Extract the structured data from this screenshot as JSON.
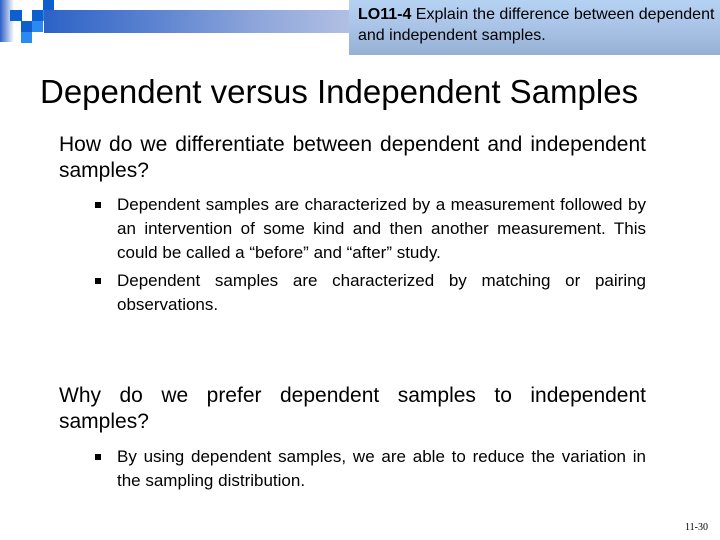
{
  "slide": {
    "learning_objective": {
      "code": "LO11-4",
      "text": " Explain the difference between dependent and independent samples."
    },
    "title": "Dependent versus Independent Samples",
    "sections": [
      {
        "question": "How do we differentiate between dependent and independent samples?",
        "bullets": [
          "Dependent samples are characterized by a measurement followed by an intervention of some kind and then another measurement. This could be called a “before” and “after” study.",
          "Dependent samples are characterized by matching or pairing observations."
        ]
      },
      {
        "question": "Why do we prefer dependent samples to independent samples?",
        "bullets": [
          "By using dependent samples, we are able to reduce the variation in the sampling distribution."
        ]
      }
    ],
    "slide_number": "11-30"
  },
  "theme": {
    "header_bar_color": "#2c62c6",
    "lo_box_color": "#a9c3e6",
    "logo_square_dark": "#0d5fd0",
    "logo_square_light": "#2a8af2"
  }
}
